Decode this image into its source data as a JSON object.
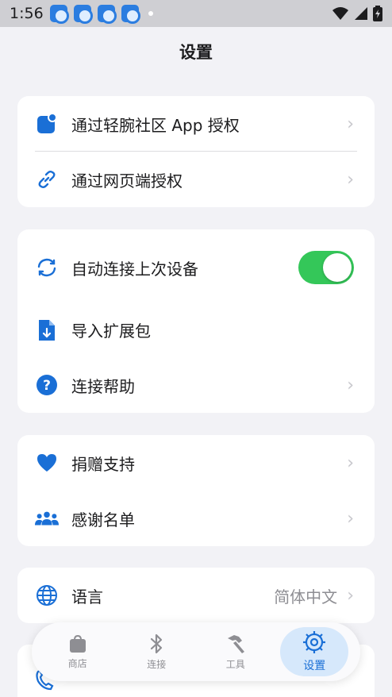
{
  "status_bar": {
    "time": "1:56"
  },
  "header": {
    "title": "设置"
  },
  "auth_card": {
    "items": [
      {
        "label": "通过轻腕社区 App 授权",
        "chevron": "›"
      },
      {
        "label": "通过网页端授权",
        "chevron": "›"
      }
    ]
  },
  "device_card": {
    "items": [
      {
        "label": "自动连接上次设备",
        "toggle_on": true
      },
      {
        "label": "导入扩展包"
      },
      {
        "label": "连接帮助",
        "chevron": "›"
      }
    ]
  },
  "support_card": {
    "items": [
      {
        "label": "捐赠支持",
        "chevron": "›"
      },
      {
        "label": "感谢名单",
        "chevron": "›"
      }
    ]
  },
  "language_card": {
    "label": "语言",
    "value": "简体中文",
    "chevron": "›"
  },
  "tabbar": {
    "tabs": [
      {
        "label": "商店",
        "icon": "shop-bag-icon"
      },
      {
        "label": "连接",
        "icon": "bluetooth-icon"
      },
      {
        "label": "工具",
        "icon": "hammer-icon"
      },
      {
        "label": "设置",
        "icon": "settings-icon",
        "active": true
      }
    ]
  },
  "colors": {
    "accent": "#1a6fd6",
    "toggle_on": "#34c759",
    "background": "#f2f2f6"
  }
}
